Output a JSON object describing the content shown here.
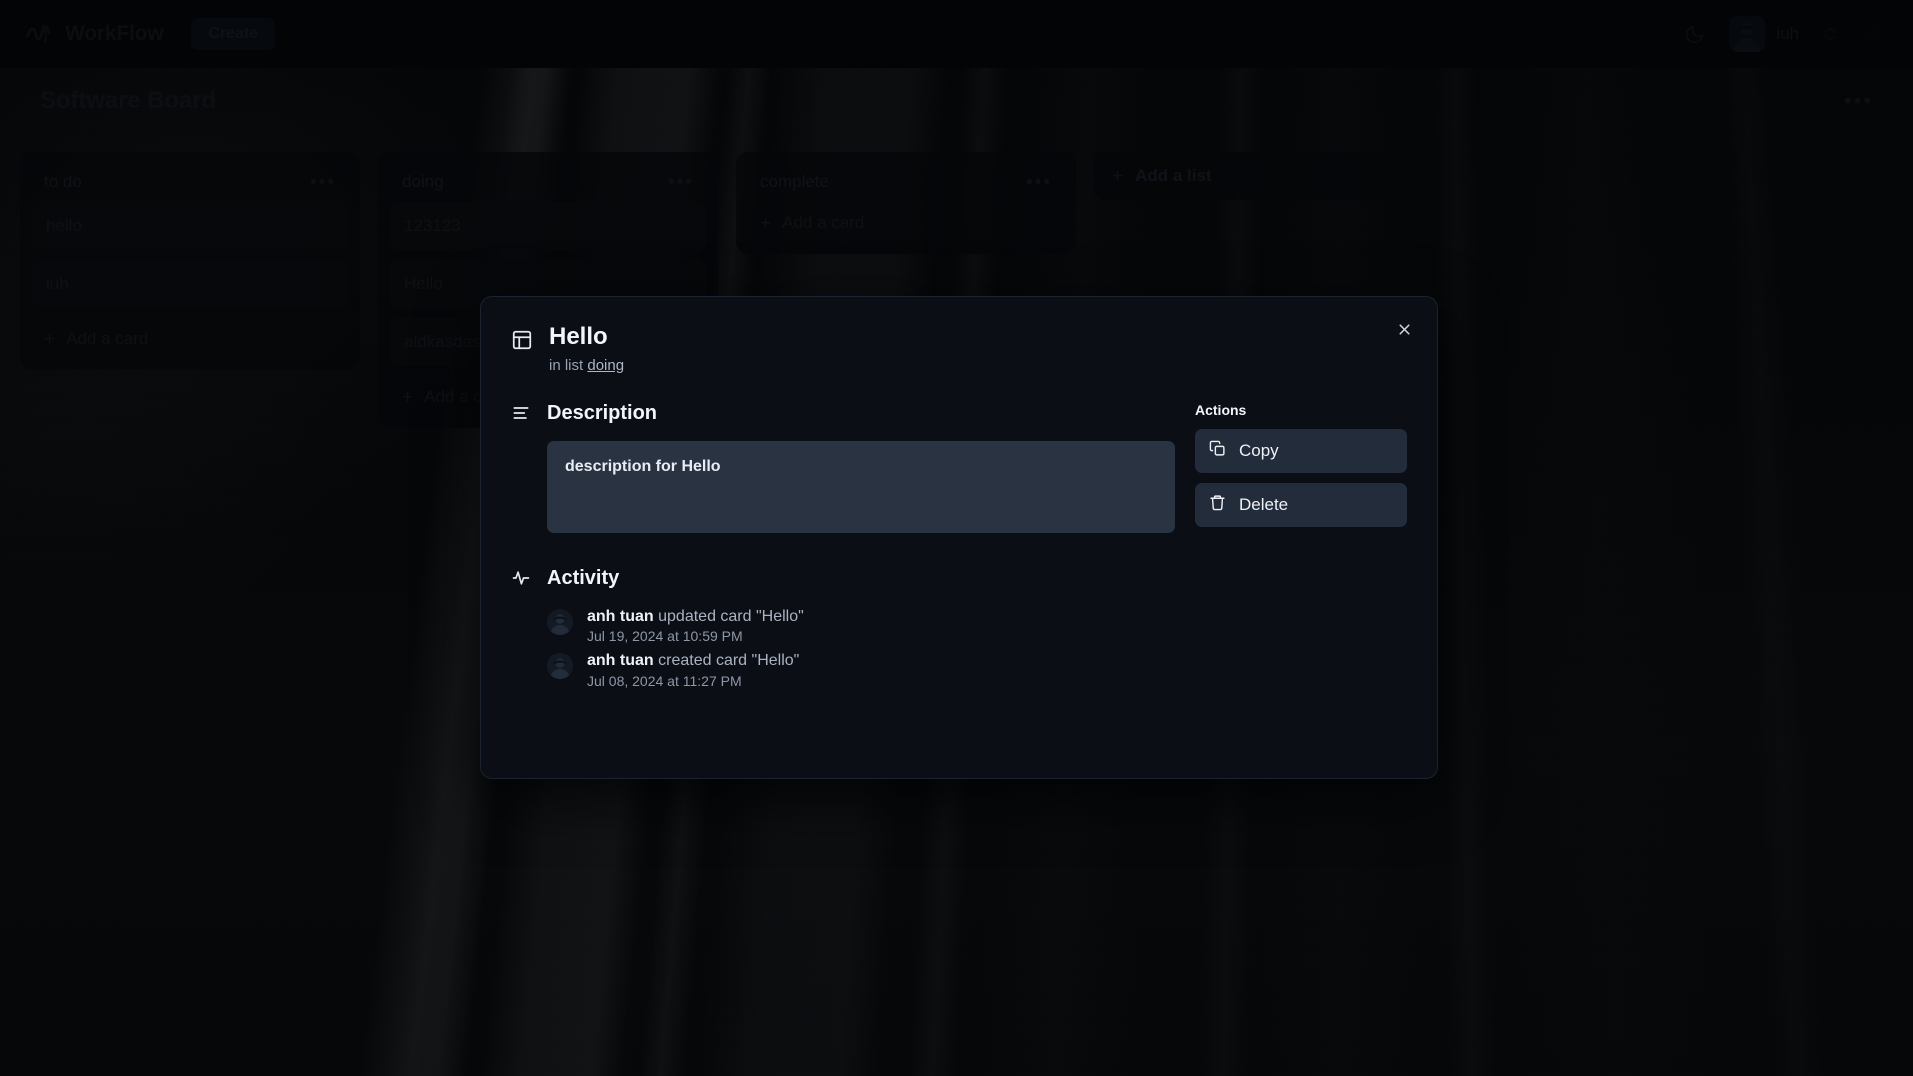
{
  "navbar": {
    "brand": "WorkFlow",
    "logo_icon": "workflow-logo-icon",
    "create_label": "Create",
    "theme_icon": "moon-icon",
    "user_name": "iuh",
    "avatar_icon": "user-avatar",
    "switcher_icon": "chevrons-up-down-icon"
  },
  "board": {
    "title": "Software Board",
    "menu_icon": "ellipsis-icon",
    "menu_glyph": "•••"
  },
  "lists": [
    {
      "title": "to do",
      "menu_glyph": "•••",
      "cards": [
        "hello",
        "iuh"
      ],
      "add_card_label": "Add a card"
    },
    {
      "title": "doing",
      "menu_glyph": "•••",
      "cards": [
        "123123",
        "Hello",
        "aldkasdasda"
      ],
      "add_card_label": "Add a card"
    },
    {
      "title": "complete",
      "menu_glyph": "•••",
      "cards": [],
      "add_card_label": "Add a card"
    }
  ],
  "add_list": {
    "label": "Add a list",
    "plus_glyph": "+"
  },
  "modal": {
    "close_icon": "close-icon",
    "header_icon": "layout-icon",
    "title": "Hello",
    "subtitle_prefix": "in list",
    "subtitle_list": "doing",
    "description": {
      "icon": "align-left-icon",
      "heading": "Description",
      "value": "description for Hello"
    },
    "actions": {
      "heading": "Actions",
      "copy_label": "Copy",
      "copy_icon": "copy-icon",
      "delete_label": "Delete",
      "delete_icon": "trash-icon"
    },
    "activity": {
      "icon": "activity-icon",
      "heading": "Activity",
      "items": [
        {
          "actor": "anh tuan",
          "action": "updated card \"Hello\"",
          "timestamp": "Jul 19, 2024 at 10:59 PM"
        },
        {
          "actor": "anh tuan",
          "action": "created card \"Hello\"",
          "timestamp": "Jul 08, 2024 at 11:27 PM"
        }
      ]
    }
  },
  "colors": {
    "page_background": "#08090d",
    "navbar_background": "#040609",
    "modal_background": "#0b0e14",
    "modal_border": "#1b2230",
    "description_background": "#2a3341",
    "action_button_background": "#232c3a",
    "muted_text": "#2a323e",
    "bright_text": "#f2f5fa"
  }
}
